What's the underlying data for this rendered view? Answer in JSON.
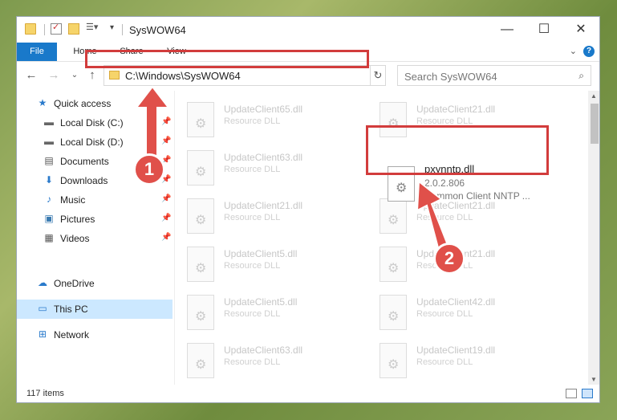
{
  "window": {
    "title": "SysWOW64"
  },
  "ribbon": {
    "tabs": [
      {
        "label": "File"
      },
      {
        "label": "Home"
      },
      {
        "label": "Share"
      },
      {
        "label": "View"
      }
    ]
  },
  "nav": {
    "address": "C:\\Windows\\SysWOW64",
    "search_placeholder": "Search SysWOW64"
  },
  "sidebar": {
    "items": [
      {
        "label": "Quick access",
        "icon": "star-icon"
      },
      {
        "label": "Local Disk (C:)",
        "icon": "drive-icon",
        "pinned": true
      },
      {
        "label": "Local Disk (D:)",
        "icon": "drive-icon",
        "pinned": true
      },
      {
        "label": "Documents",
        "icon": "documents-icon",
        "pinned": true
      },
      {
        "label": "Downloads",
        "icon": "download-icon",
        "pinned": true
      },
      {
        "label": "Music",
        "icon": "music-icon",
        "pinned": true
      },
      {
        "label": "Pictures",
        "icon": "pictures-icon",
        "pinned": true
      },
      {
        "label": "Videos",
        "icon": "videos-icon",
        "pinned": true
      },
      {
        "label": "OneDrive",
        "icon": "cloud-icon"
      },
      {
        "label": "This PC",
        "icon": "computer-icon",
        "selected": true
      },
      {
        "label": "Network",
        "icon": "network-icon"
      }
    ]
  },
  "files": [
    {
      "name": "UpdateClient65.dll",
      "type": "Resource DLL"
    },
    {
      "name": "UpdateClient21.dll",
      "type": "Resource DLL"
    },
    {
      "name": "UpdateClient63.dll",
      "type": "Resource DLL"
    },
    {
      "name": "UpdateClient21.dll",
      "type": "Resource DLL"
    },
    {
      "name": "UpdateClient21.dll",
      "type": "Resource DLL"
    },
    {
      "name": "UpdateClient5.dll",
      "type": "Resource DLL"
    },
    {
      "name": "UpdateClient21.dll",
      "type": "Resource DLL"
    },
    {
      "name": "UpdateClient5.dll",
      "type": "Resource DLL"
    },
    {
      "name": "UpdateClient42.dll",
      "type": "Resource DLL"
    },
    {
      "name": "UpdateClient63.dll",
      "type": "Resource DLL"
    },
    {
      "name": "UpdateClient19.dll",
      "type": "Resource DLL"
    }
  ],
  "highlighted_file": {
    "name": "pxynntp.dll",
    "version": "2.0.2.806",
    "description": "Common Client NNTP ..."
  },
  "status": {
    "item_count": "117 items"
  },
  "annotations": {
    "badge1": "1",
    "badge2": "2",
    "accent_color": "#e0504a"
  }
}
